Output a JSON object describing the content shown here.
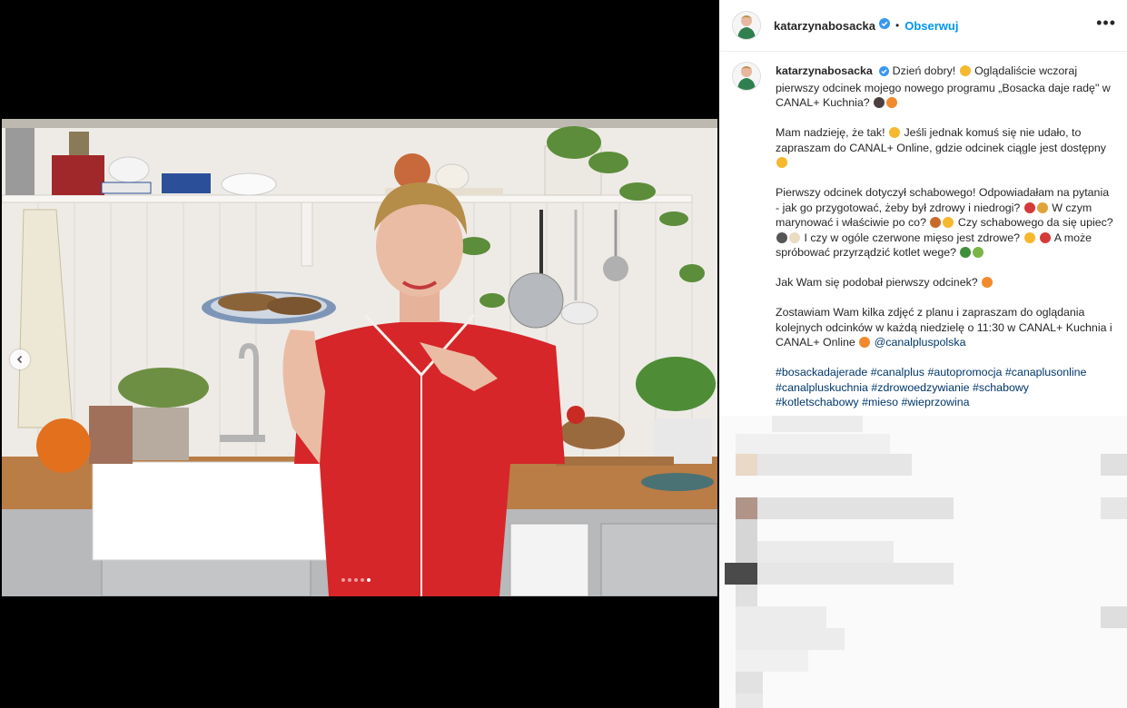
{
  "post": {
    "username": "katarzynabosacka",
    "separator": "•",
    "follow_label": "Obserwuj",
    "more_label": "•••"
  },
  "caption": {
    "username": "katarzynabosacka",
    "p1_a": "Dzień dobry!",
    "p1_b": "Oglądaliście wczoraj pierwszy odcinek mojego nowego programu „Bosacka daje radę\" w CANAL+ Kuchnia?",
    "p2_a": "Mam nadzieję, że tak!",
    "p2_b": "Jeśli jednak komuś się nie udało, to zapraszam do CANAL+ Online, gdzie odcinek ciągle jest dostępny",
    "p3_a": "Pierwszy odcinek dotyczył schabowego! Odpowiadałam na pytania - jak go przygotować, żeby był zdrowy i niedrogi?",
    "p3_b": "W czym marynować i właściwie po co?",
    "p3_c": "Czy schabowego da się upiec?",
    "p3_d": "I czy w ogóle czerwone mięso jest zdrowe?",
    "p3_e": "A może spróbować przyrządzić kotlet wege?",
    "p4": "Jak Wam się podobał pierwszy odcinek?",
    "p5": "Zostawiam Wam kilka zdjęć z planu i zapraszam do oglądania kolejnych odcinków w każdą niedzielę o 11:30 w CANAL+ Kuchnia i CANAL+ Online",
    "mention": "@canalpluspolska",
    "hashtags": [
      "#bosackadajerade",
      "#canalplus",
      "#autopromocja",
      "#canaplusonline",
      "#canalpluskuchnia",
      "#zdrowoedzywianie",
      "#schabowy",
      "#kotletschabowy",
      "#mieso",
      "#wieprzowina"
    ]
  },
  "carousel": {
    "count": 5,
    "active_index": 4
  },
  "icons": {
    "verified": "verified-badge-icon",
    "prev": "chevron-left-icon",
    "more": "more-horizontal-icon"
  },
  "colors": {
    "link": "#0095f6",
    "hashtag": "#00376b",
    "text": "#262626",
    "verified": "#3897f0",
    "shirt": "#d6262a"
  }
}
